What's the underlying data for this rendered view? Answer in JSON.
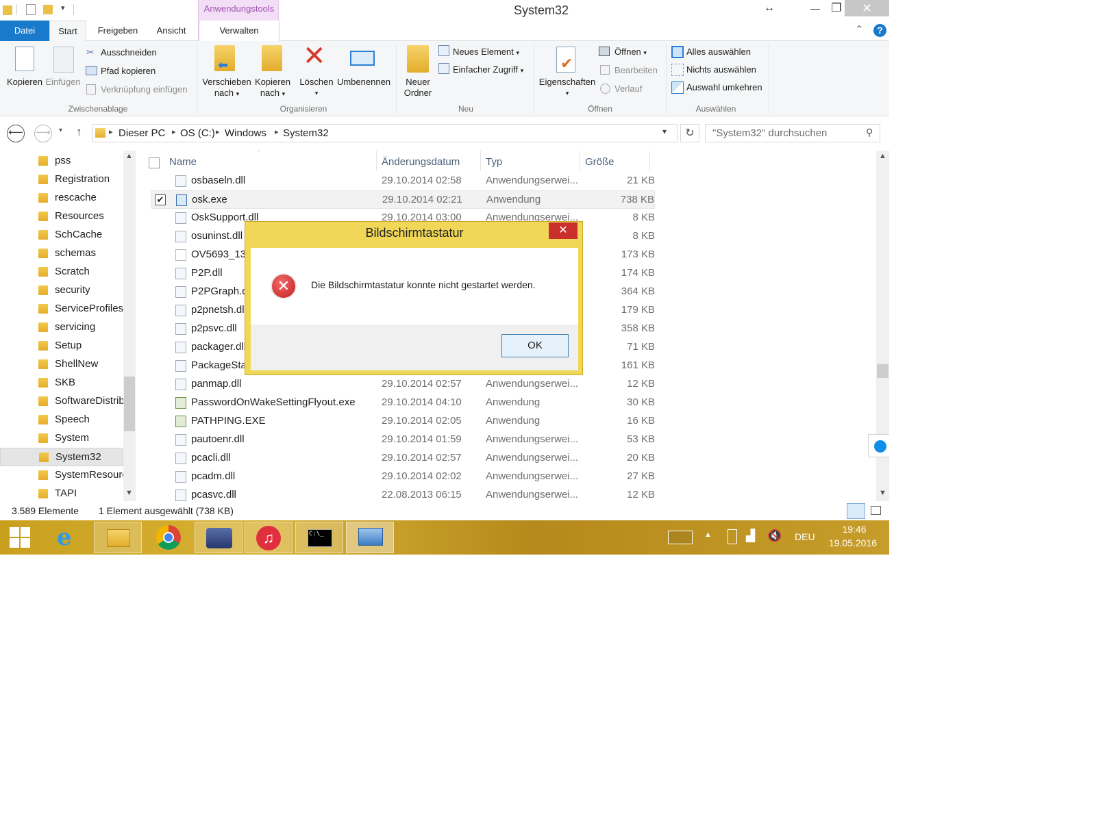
{
  "title_bar": {
    "title": "System32",
    "contextual_tab": "Anwendungstools",
    "restore_glyph": "↔",
    "minimize_glyph": "—",
    "maximize_glyph": "❐",
    "close_glyph": "✕"
  },
  "tabs": [
    "Datei",
    "Start",
    "Freigeben",
    "Ansicht",
    "Verwalten"
  ],
  "ribbon": {
    "clipboard": {
      "copy": "Kopieren",
      "paste": "Einfügen",
      "cut": "Ausschneiden",
      "copy_path": "Pfad kopieren",
      "paste_shortcut": "Verknüpfung einfügen",
      "label": "Zwischenablage"
    },
    "organize": {
      "move_to_1": "Verschieben",
      "move_to_2": "nach",
      "copy_to_1": "Kopieren",
      "copy_to_2": "nach",
      "delete": "Löschen",
      "rename": "Umbenennen",
      "label": "Organisieren"
    },
    "new": {
      "new_folder_1": "Neuer",
      "new_folder_2": "Ordner",
      "new_item": "Neues Element",
      "easy_access": "Einfacher Zugriff",
      "label": "Neu"
    },
    "open": {
      "properties": "Eigenschaften",
      "open": "Öffnen",
      "edit": "Bearbeiten",
      "history": "Verlauf",
      "label": "Öffnen"
    },
    "select": {
      "select_all": "Alles auswählen",
      "select_none": "Nichts auswählen",
      "invert": "Auswahl umkehren",
      "label": "Auswählen"
    }
  },
  "address": {
    "crumbs": [
      "Dieser PC",
      "OS (C:)",
      "Windows",
      "System32"
    ],
    "search_placeholder": "\"System32\" durchsuchen"
  },
  "nav_items": [
    "pss",
    "Registration",
    "rescache",
    "Resources",
    "SchCache",
    "schemas",
    "Scratch",
    "security",
    "ServiceProfiles",
    "servicing",
    "Setup",
    "ShellNew",
    "SKB",
    "SoftwareDistribution",
    "Speech",
    "System",
    "System32",
    "SystemResources",
    "TAPI"
  ],
  "columns": {
    "name": "Name",
    "date": "Änderungsdatum",
    "type": "Typ",
    "size": "Größe"
  },
  "files": [
    {
      "name": "osbaseln.dll",
      "date": "29.10.2014 02:58",
      "type": "Anwendungserwei...",
      "size": "21 KB"
    },
    {
      "name": "osk.exe",
      "date": "29.10.2014 02:21",
      "type": "Anwendung",
      "size": "738 KB"
    },
    {
      "name": "OskSupport.dll",
      "date": "29.10.2014 03:00",
      "type": "Anwendungserwei...",
      "size": "8 KB"
    },
    {
      "name": "osuninst.dll",
      "date": "",
      "type": "",
      "size": "8 KB"
    },
    {
      "name": "OV5693_13P2",
      "date": "",
      "type": "",
      "size": "173 KB"
    },
    {
      "name": "P2P.dll",
      "date": "",
      "type": "",
      "size": "174 KB"
    },
    {
      "name": "P2PGraph.dll",
      "date": "",
      "type": "",
      "size": "364 KB"
    },
    {
      "name": "p2pnetsh.dll",
      "date": "",
      "type": "",
      "size": "179 KB"
    },
    {
      "name": "p2psvc.dll",
      "date": "",
      "type": "",
      "size": "358 KB"
    },
    {
      "name": "packager.dll",
      "date": "",
      "type": "",
      "size": "71 KB"
    },
    {
      "name": "PackageState",
      "date": "",
      "type": "",
      "size": "161 KB"
    },
    {
      "name": "panmap.dll",
      "date": "29.10.2014 02:57",
      "type": "Anwendungserwei...",
      "size": "12 KB"
    },
    {
      "name": "PasswordOnWakeSettingFlyout.exe",
      "date": "29.10.2014 04:10",
      "type": "Anwendung",
      "size": "30 KB"
    },
    {
      "name": "PATHPING.EXE",
      "date": "29.10.2014 02:05",
      "type": "Anwendung",
      "size": "16 KB"
    },
    {
      "name": "pautoenr.dll",
      "date": "29.10.2014 01:59",
      "type": "Anwendungserwei...",
      "size": "53 KB"
    },
    {
      "name": "pcacli.dll",
      "date": "29.10.2014 02:57",
      "type": "Anwendungserwei...",
      "size": "20 KB"
    },
    {
      "name": "pcadm.dll",
      "date": "29.10.2014 02:02",
      "type": "Anwendungserwei...",
      "size": "27 KB"
    },
    {
      "name": "pcasvc.dll",
      "date": "22.08.2013 06:15",
      "type": "Anwendungserwei...",
      "size": "12 KB"
    }
  ],
  "status": {
    "count": "3.589 Elemente",
    "selection": "1 Element ausgewählt (738 KB)"
  },
  "dialog": {
    "title": "Bildschirmtastatur",
    "message": "Die Bildschirmtastatur konnte nicht gestartet werden.",
    "ok": "OK",
    "close_glyph": "✕"
  },
  "taskbar": {
    "lang": "DEU",
    "time": "19:46",
    "date": "19.05.2016"
  },
  "colors": {
    "accent": "#1979ca",
    "dialog_frame": "#f0d758",
    "error_red": "#c9302c",
    "taskbar": "#c9a01e"
  }
}
